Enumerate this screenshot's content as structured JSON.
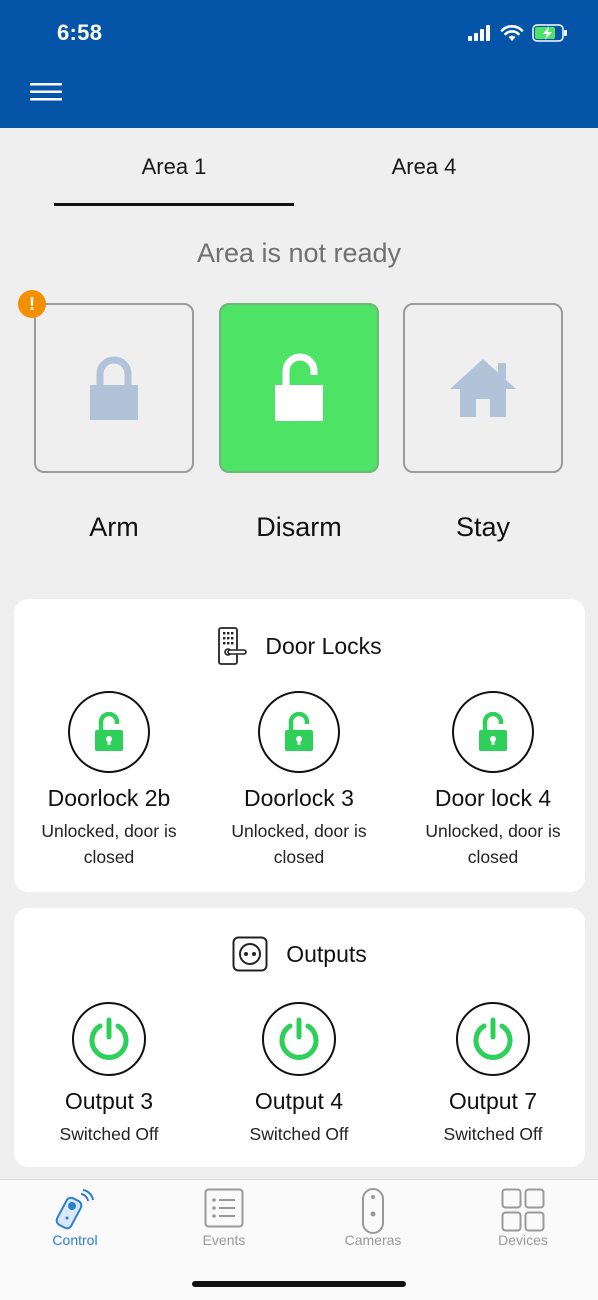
{
  "status_bar": {
    "time": "6:58"
  },
  "tabs": [
    {
      "label": "Area 1",
      "active": true
    },
    {
      "label": "Area 4",
      "active": false
    }
  ],
  "area_status": "Area is not ready",
  "warning_badge": "!",
  "modes": [
    {
      "label": "Arm",
      "icon": "lock-closed-icon",
      "active": false
    },
    {
      "label": "Disarm",
      "icon": "lock-open-icon",
      "active": true
    },
    {
      "label": "Stay",
      "icon": "house-icon",
      "active": false
    }
  ],
  "door_locks": {
    "title": "Door Locks",
    "items": [
      {
        "name": "Doorlock 2b",
        "status": "Unlocked, door is closed"
      },
      {
        "name": "Doorlock 3",
        "status": "Unlocked, door is closed"
      },
      {
        "name": "Door lock 4",
        "status": "Unlocked, door is closed"
      }
    ]
  },
  "outputs": {
    "title": "Outputs",
    "items": [
      {
        "name": "Output 3",
        "status": "Switched Off"
      },
      {
        "name": "Output 4",
        "status": "Switched Off"
      },
      {
        "name": "Output 7",
        "status": "Switched Off"
      }
    ]
  },
  "bottom_nav": [
    {
      "label": "Control",
      "active": true
    },
    {
      "label": "Events",
      "active": false
    },
    {
      "label": "Cameras",
      "active": false
    },
    {
      "label": "Devices",
      "active": false
    }
  ],
  "colors": {
    "header_blue": "#0455a8",
    "active_green": "#4de466",
    "icon_green": "#2fd05a",
    "inactive_icon": "#b0c3d8",
    "warning_orange": "#f39000",
    "nav_active": "#2a7fd1"
  }
}
